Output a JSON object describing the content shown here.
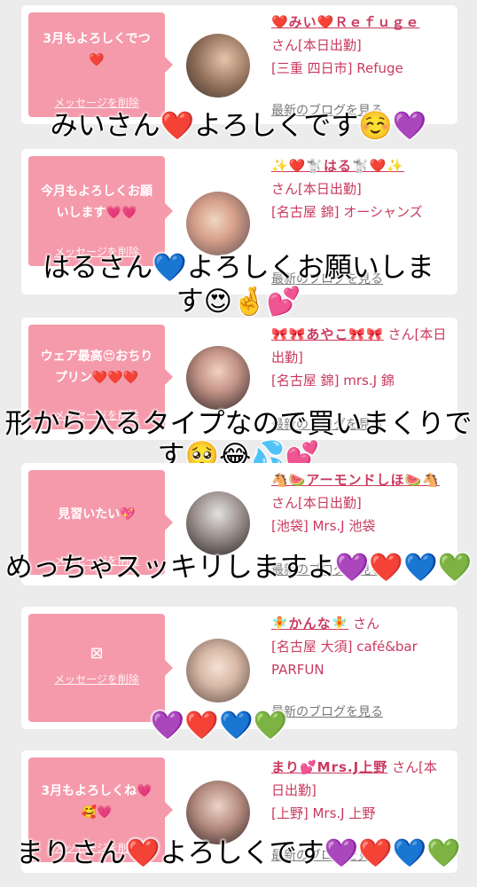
{
  "entries": [
    {
      "message": "3月もよろしくでつ❤️",
      "delete_label": "メッセージを削除",
      "name": "❤️みい❤️Ｒｅｆｕｇｅ",
      "suffix": "さん[本日出勤]",
      "location": "[三重 四日市] Refuge",
      "blog_label": "最新のブログを見る",
      "overlay": "みいさん❤️よろしくです☺️💜"
    },
    {
      "message": "今月もよろしくお願いします💗💗",
      "delete_label": "メッセージを削除",
      "name": "✨❤️🐩はる🐩❤️✨",
      "suffix": "さん[本日出勤]",
      "location": "[名古屋 錦] オーシャンズ",
      "blog_label": "最新のブログを見る",
      "overlay_line1": "はるさん💙よろしくお願いしま",
      "overlay_line2": "す😍🤞💕"
    },
    {
      "message": "ウェア最高😍おちりプリン❤️❤️❤️",
      "delete_label": "メッセージを削除",
      "name": "🎀🎀あやこ🎀🎀",
      "suffix": "さん[本日出勤]",
      "location": "[名古屋 錦] mrs.J 錦",
      "blog_label": "最新のブログを見る",
      "overlay_line1": "形から入るタイプなので買いまくりで",
      "overlay_line2": "す🥺😂💦💕"
    },
    {
      "message": "見習いたい💖",
      "delete_label": "メッセージを削除",
      "name": "🐴🍉アーモンドしほ🍉🐴",
      "suffix": "さん[本日出勤]",
      "location": "[池袋] Mrs.J 池袋",
      "blog_label": "最新のブログを見る",
      "overlay": "めっちゃスッキリしますよ💜❤️💙💚"
    },
    {
      "message": "⊠",
      "delete_label": "メッセージを削除",
      "name": "🧚かんな🧚",
      "suffix": "さん",
      "location": "[名古屋 大須] café&bar PARFUN",
      "blog_label": "最新のブログを見る",
      "overlay": "💜❤️💙💚"
    },
    {
      "message": "3月もよろしくね💗🥰💗",
      "delete_label": "メッセージを削除",
      "name": "まり💕Mrs.J上野",
      "suffix": "さん[本日出勤]",
      "location": "[上野] Mrs.J 上野",
      "blog_label": "最新のブログを見る",
      "overlay": "まりさん❤️よろしくです💜❤️💙💚"
    }
  ],
  "colors": {
    "bubble": "#f59aab",
    "link": "#c93a5f",
    "background": "#ececec"
  }
}
